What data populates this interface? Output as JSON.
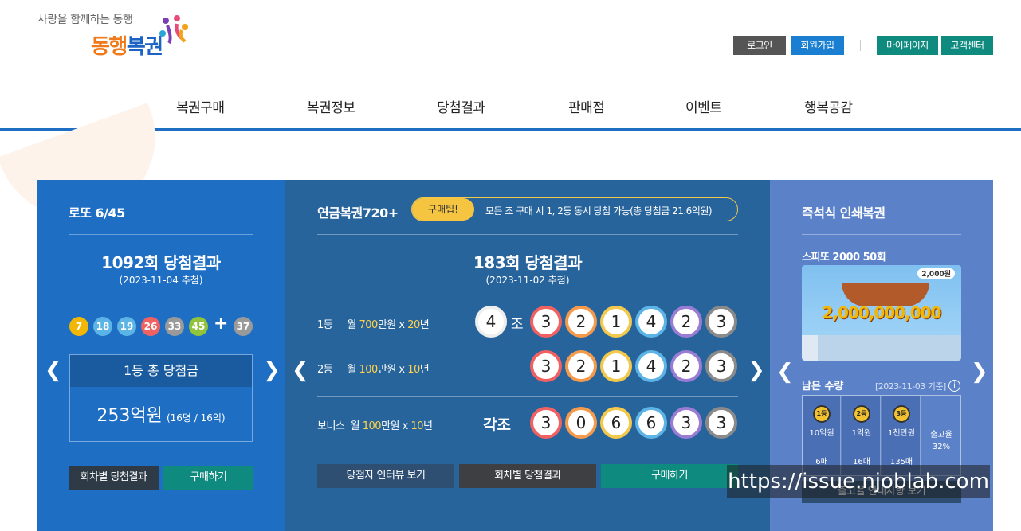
{
  "header": {
    "slogan": "사랑을 함께하는 동행",
    "logo_part1": "동행",
    "logo_part2": "복권",
    "buttons": [
      {
        "label": "로그인",
        "color": "#555555"
      },
      {
        "label": "회원가입",
        "color": "#1a7fd1"
      },
      {
        "label": "마이페이지",
        "color": "#0f8a7e"
      },
      {
        "label": "고객센터",
        "color": "#0f8a7e"
      }
    ]
  },
  "nav": [
    "복권구매",
    "복권정보",
    "당첨결과",
    "판매점",
    "이벤트",
    "행복공감"
  ],
  "lotto": {
    "title": "로또 6/45",
    "round_title": "1092회 당첨결과",
    "date": "(2023-11-04 추첨)",
    "numbers": [
      {
        "n": "7",
        "color": "#f2b705"
      },
      {
        "n": "18",
        "color": "#5cb3e6"
      },
      {
        "n": "19",
        "color": "#5cb3e6"
      },
      {
        "n": "26",
        "color": "#f06262"
      },
      {
        "n": "33",
        "color": "#9a9a9a"
      },
      {
        "n": "45",
        "color": "#92c43a"
      }
    ],
    "plus": "+",
    "bonus": {
      "n": "37",
      "color": "#9a9a9a"
    },
    "prize_label": "1등 총 당첨금",
    "prize_amount": "253억원",
    "prize_detail": "(16명 / 16억)",
    "btn_history": "회차별 당첨결과",
    "btn_buy": "구매하기"
  },
  "pension": {
    "title": "연금복권720+",
    "tip_label": "구매팁!",
    "tip_text": "모든 조 구매 시 1, 2등 동시 당첨 가능(총 당첨금 21.6억원)",
    "round_title": "183회 당첨결과",
    "date": "(2023-11-02 추첨)",
    "rows": [
      {
        "rank": "1등",
        "pre": "월 ",
        "amt": "700",
        "mid": "만원 x ",
        "yrs": "20",
        "post": "년"
      },
      {
        "rank": "2등",
        "pre": "월 ",
        "amt": "100",
        "mid": "만원 x ",
        "yrs": "10",
        "post": "년"
      },
      {
        "rank": "보너스",
        "pre": "월 ",
        "amt": "100",
        "mid": "만원 x ",
        "yrs": "10",
        "post": "년"
      }
    ],
    "group_num": "4",
    "group_label": "조",
    "each_group": "각조",
    "digits1": [
      "3",
      "2",
      "1",
      "4",
      "2",
      "3"
    ],
    "digits2": [
      "3",
      "2",
      "1",
      "4",
      "2",
      "3"
    ],
    "digits3": [
      "3",
      "0",
      "6",
      "6",
      "3",
      "3"
    ],
    "ring_colors": [
      "#f06262",
      "#f49a4a",
      "#f2c94c",
      "#5cb3e6",
      "#9a7cd4",
      "#8a8a8a"
    ],
    "btn_interview": "당첨자 인터뷰 보기",
    "btn_history": "회차별 당첨결과",
    "btn_buy": "구매하기"
  },
  "instant": {
    "title": "즉석식 인쇄복권",
    "product": "스피또 2000 50회",
    "ticket_amount": "2,000,000,000",
    "ticket_price": "2,000원",
    "remain_label": "남은 수량",
    "remain_date": "[2023-11-03 기준]",
    "columns": [
      {
        "medal": "1등",
        "prize": "10억원",
        "count": "6매"
      },
      {
        "medal": "2등",
        "prize": "1억원",
        "count": "16매"
      },
      {
        "medal": "3등",
        "prize": "1천만원",
        "count": "135매"
      }
    ],
    "ship_label": "출고율",
    "ship_rate": "32%",
    "btn_guide": "출고율 안내사항 보기"
  },
  "watermark": "https://issue.njoblab.com"
}
